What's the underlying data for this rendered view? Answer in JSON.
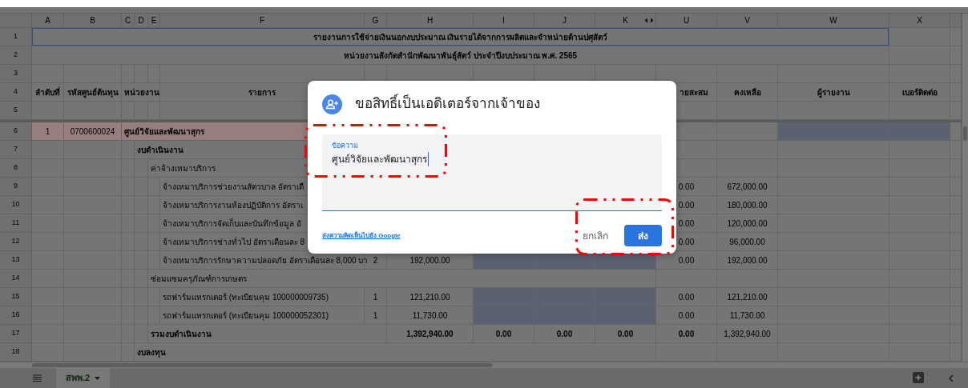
{
  "sheet": {
    "columns": [
      {
        "label": "A",
        "hidden_after": false
      },
      {
        "label": "B",
        "hidden_after": false
      },
      {
        "label": "C",
        "hidden_after": false
      },
      {
        "label": "D",
        "hidden_after": false
      },
      {
        "label": "E",
        "hidden_after": false
      },
      {
        "label": "F",
        "hidden_after": false
      },
      {
        "label": "G",
        "hidden_after": false
      },
      {
        "label": "H",
        "hidden_after": false
      },
      {
        "label": "I",
        "hidden_after": false
      },
      {
        "label": "J",
        "hidden_after": false
      },
      {
        "label": "K",
        "hidden_after": true
      },
      {
        "label": "U",
        "hidden_after": false
      },
      {
        "label": "V",
        "hidden_after": false
      },
      {
        "label": "W",
        "hidden_after": false
      },
      {
        "label": "X",
        "hidden_after": false
      }
    ],
    "rows": [
      {
        "number": "1",
        "kind": "title",
        "selected": true,
        "highlighted": false,
        "cells": [
          {
            "text": "รายงานการใช้จ่ายเงินนอกงบประมาณ เงินรายได้จากการผลิตและจำหน่ายด้านปศุสัตว์"
          },
          null,
          null,
          null,
          null,
          null,
          null,
          null,
          null,
          null,
          null,
          null,
          null,
          null,
          null
        ]
      },
      {
        "number": "2",
        "kind": "title",
        "selected": false,
        "highlighted": false,
        "cells": [
          {
            "text": "หน่วยงานสังกัดสำนักพัฒนาพันธุ์สัตว์ ประจำปีงบประมาณ พ.ศ. 2565"
          },
          null,
          null,
          null,
          null,
          null,
          null,
          null,
          null,
          null,
          null,
          null,
          null,
          null,
          null
        ]
      },
      {
        "number": "3",
        "kind": "data",
        "selected": false,
        "highlighted": false
      },
      {
        "number": "4",
        "kind": "header",
        "selected": false,
        "highlighted": false,
        "cells": [
          {
            "text": "ลำดับที่"
          },
          {
            "text": "รหัสศูนย์ต้นทุน"
          },
          {
            "text": "หน่วยงาน"
          },
          null,
          null,
          {
            "text": "รายการ"
          },
          null,
          null,
          null,
          null,
          null,
          {
            "text": "ายสะสม"
          },
          {
            "text": "คงเหลือ"
          },
          {
            "text": "ผู้รายงาน"
          },
          {
            "text": "เบอร์ติดต่อ"
          }
        ]
      },
      {
        "number": "5",
        "kind": "data",
        "selected": false,
        "highlighted": false
      },
      {
        "number": "6",
        "kind": "data",
        "selected": false,
        "highlighted": true,
        "cells": [
          {
            "text": "1"
          },
          {
            "text": "0700600024"
          },
          {
            "text": "ศูนย์วิจัยและพัฒนาสุกร",
            "bold": true
          },
          null,
          null,
          null,
          null,
          null,
          null,
          null,
          null,
          null,
          null,
          {
            "shaded": true
          },
          {
            "shaded": true
          }
        ]
      },
      {
        "number": "7",
        "kind": "data",
        "selected": false,
        "highlighted": false,
        "cells": [
          null,
          null,
          null,
          {
            "text": "งบดำเนินงาน",
            "bold": true
          },
          null,
          null,
          null,
          null,
          null,
          null,
          null,
          null,
          null,
          null,
          null
        ]
      },
      {
        "number": "8",
        "kind": "data",
        "selected": false,
        "highlighted": false,
        "cells": [
          null,
          null,
          null,
          null,
          {
            "text": "ค่าจ้างเหมาบริการ"
          },
          null,
          null,
          null,
          null,
          null,
          null,
          null,
          null,
          null,
          null
        ]
      },
      {
        "number": "9",
        "kind": "data",
        "selected": false,
        "highlighted": false,
        "cells": [
          null,
          null,
          null,
          null,
          null,
          {
            "text": "จ้างเหมาบริการช่วยงานสัตวบาล อัตราเดื"
          },
          null,
          null,
          null,
          null,
          null,
          {
            "text": "0.00"
          },
          {
            "text": "672,000.00"
          },
          null,
          null
        ]
      },
      {
        "number": "10",
        "kind": "data",
        "selected": false,
        "highlighted": false,
        "cells": [
          null,
          null,
          null,
          null,
          null,
          {
            "text": "จ้างเหมาบริการงานห้องปฏิบัติการ อัตราเ"
          },
          null,
          null,
          null,
          null,
          null,
          {
            "text": "0.00"
          },
          {
            "text": "180,000.00"
          },
          null,
          null
        ]
      },
      {
        "number": "11",
        "kind": "data",
        "selected": false,
        "highlighted": false,
        "cells": [
          null,
          null,
          null,
          null,
          null,
          {
            "text": "จ้างเหมาบริการจัดเก็บและบันทึกข้อมูล อั"
          },
          null,
          null,
          null,
          null,
          null,
          {
            "text": "0.00"
          },
          {
            "text": "120,000.00"
          },
          null,
          null
        ]
      },
      {
        "number": "12",
        "kind": "data",
        "selected": false,
        "highlighted": false,
        "cells": [
          null,
          null,
          null,
          null,
          null,
          {
            "text": "จ้างเหมาบริการช่างทั่วไป อัตราเดือนละ 8"
          },
          null,
          null,
          null,
          null,
          null,
          {
            "text": "0.00"
          },
          {
            "text": "96,000.00"
          },
          null,
          null
        ]
      },
      {
        "number": "13",
        "kind": "data",
        "selected": false,
        "highlighted": false,
        "cells": [
          null,
          null,
          null,
          null,
          null,
          {
            "text": "จ้างเหมาบริการรักษาความปลอดภัย อัตราเดือนละ 8,000 บา"
          },
          {
            "text": "2"
          },
          {
            "text": "192,000.00"
          },
          {
            "shaded": true
          },
          {
            "shaded": true
          },
          {
            "shaded": true
          },
          {
            "text": "0.00"
          },
          {
            "text": "192,000.00"
          },
          null,
          null
        ]
      },
      {
        "number": "14",
        "kind": "data",
        "selected": false,
        "highlighted": false,
        "cells": [
          null,
          null,
          null,
          null,
          {
            "text": "ซ่อมแซมครุภัณฑ์การเกษตร"
          },
          null,
          null,
          null,
          null,
          null,
          null,
          null,
          null,
          null,
          null
        ]
      },
      {
        "number": "15",
        "kind": "data",
        "selected": false,
        "highlighted": false,
        "cells": [
          null,
          null,
          null,
          null,
          null,
          {
            "text": "รถฟาร์มแทรกเตอร์ (ทะเบียนคุม 100000009735)"
          },
          {
            "text": "1"
          },
          {
            "text": "121,210.00"
          },
          {
            "shaded": true
          },
          {
            "shaded": true
          },
          {
            "shaded": true
          },
          {
            "text": "0.00"
          },
          {
            "text": "121,210.00"
          },
          null,
          null
        ]
      },
      {
        "number": "16",
        "kind": "data",
        "selected": false,
        "highlighted": false,
        "cells": [
          null,
          null,
          null,
          null,
          null,
          {
            "text": "รถฟาร์มแทรกเตอร์ (ทะเบียนคุม 100000052301)"
          },
          {
            "text": "1"
          },
          {
            "text": "11,730.00"
          },
          {
            "shaded": true
          },
          {
            "shaded": true
          },
          {
            "shaded": true
          },
          {
            "text": "0.00"
          },
          {
            "text": "11,730.00"
          },
          null,
          null
        ]
      },
      {
        "number": "17",
        "kind": "data",
        "selected": false,
        "highlighted": false,
        "cells": [
          null,
          null,
          null,
          null,
          {
            "text": "รวมงบดำเนินงาน",
            "bold": true
          },
          null,
          null,
          {
            "text": "1,392,940.00",
            "bold": true
          },
          {
            "text": "0.00",
            "bold": true
          },
          {
            "text": "0.00",
            "bold": true
          },
          {
            "text": "0.00",
            "bold": true
          },
          {
            "text": "0.00",
            "bold": true
          },
          {
            "text": "1,392,940.00"
          },
          null,
          null
        ]
      },
      {
        "number": "18",
        "kind": "data",
        "selected": false,
        "highlighted": false,
        "cells": [
          null,
          null,
          null,
          {
            "text": "งบลงทุน",
            "bold": true
          },
          null,
          null,
          null,
          null,
          null,
          null,
          null,
          null,
          null,
          null,
          null
        ]
      }
    ]
  },
  "dialog": {
    "title": "ขอสิทธิ์เป็นเอดิเตอร์จากเจ้าของ",
    "field": {
      "label": "ข้อความ",
      "value": "ศูนย์วิจัยและพัฒนาสุกร"
    },
    "feedback_link": "ส่งความคิดเห็นไปยัง Google",
    "buttons": [
      {
        "label": "ยกเลิก",
        "kind": "text"
      },
      {
        "label": "ส่ง",
        "kind": "primary"
      }
    ]
  },
  "sheet_tabs": [
    {
      "label": "สพพ.2",
      "selected": true
    }
  ]
}
